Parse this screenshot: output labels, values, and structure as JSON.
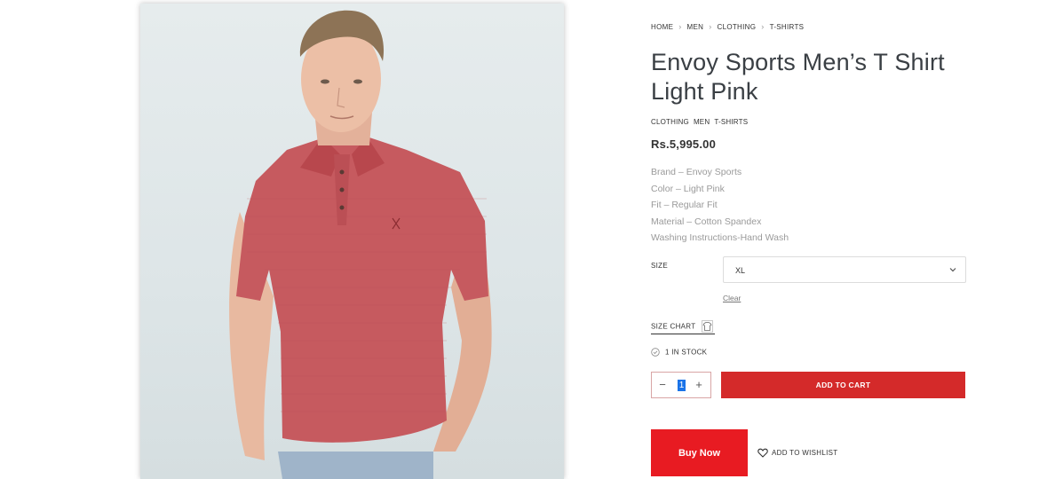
{
  "breadcrumb": [
    "HOME",
    "MEN",
    "CLOTHING",
    "T-SHIRTS"
  ],
  "breadcrumb_separator": "›",
  "product": {
    "title": "Envoy Sports Men’s T Shirt Light Pink",
    "categories": [
      "CLOTHING",
      "MEN",
      "T-SHIRTS"
    ],
    "price": "Rs.5,995.00",
    "details": [
      "Brand – Envoy Sports",
      "Color – Light Pink",
      "Fit – Regular Fit",
      "Material – Cotton Spandex",
      "Washing Instructions-Hand Wash"
    ],
    "image_icon": "product-photo-man-in-pink-polo"
  },
  "variation": {
    "label": "SIZE",
    "selected": "XL",
    "clear_label": "Clear"
  },
  "size_chart": {
    "label": "SIZE CHART",
    "icon": "tshirt-icon"
  },
  "stock": {
    "text": "1 IN STOCK",
    "icon": "check-circle-icon"
  },
  "quantity": {
    "value": "1",
    "minus": "−",
    "plus": "+"
  },
  "actions": {
    "add_to_cart": "ADD TO CART",
    "buy_now": "Buy Now",
    "wishlist": "ADD TO WISHLIST",
    "wishlist_icon": "heart-icon"
  },
  "colors": {
    "accent_red": "#d42a2a",
    "buy_now_red": "#e81b22",
    "shirt": "#c65a5f"
  }
}
